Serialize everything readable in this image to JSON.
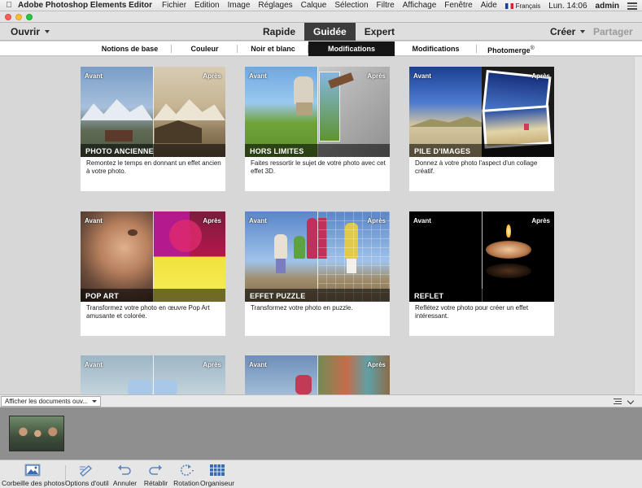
{
  "menubar": {
    "app_name": "Adobe Photoshop Elements Editor",
    "items": [
      "Fichier",
      "Edition",
      "Image",
      "Réglages",
      "Calque",
      "Sélection",
      "Filtre",
      "Affichage",
      "Fenêtre",
      "Aide"
    ],
    "language": "Français",
    "clock": "Lun. 14:06",
    "user": "admin"
  },
  "modebar": {
    "open_label": "Ouvrir",
    "modes": [
      "Rapide",
      "Guidée",
      "Expert"
    ],
    "active_mode": "Guidée",
    "create_label": "Créer",
    "share_label": "Partager"
  },
  "categories": {
    "items": [
      "Notions de base",
      "Couleur",
      "Noir et blanc",
      "Modifications amusantes",
      "Modifications spéciales",
      "Photomerge"
    ],
    "photomerge_mark": "®",
    "active": "Modifications amusantes"
  },
  "cards": {
    "before": "Avant",
    "after": "Après",
    "items": [
      {
        "title": "PHOTO ANCIENNE",
        "desc": "Remontez le temps en donnant un effet ancien à votre photo."
      },
      {
        "title": "HORS LIMITES",
        "desc": "Faites ressortir le sujet de votre photo avec cet effet 3D."
      },
      {
        "title": "PILE D'IMAGES",
        "desc": "Donnez à votre photo l'aspect d'un collage créatif."
      },
      {
        "title": "POP ART",
        "desc": "Transformez votre photo en œuvre Pop Art amusante et colorée."
      },
      {
        "title": "EFFET PUZZLE",
        "desc": "Transformez votre photo en puzzle."
      },
      {
        "title": "REFLET",
        "desc": "Reflétez votre photo pour créer un effet intéressant."
      }
    ]
  },
  "binbar": {
    "dropdown_value": "Afficher les documents ouv..."
  },
  "toolbar": {
    "items": [
      "Corbeille des photos",
      "Options d'outil",
      "Annuler",
      "Rétablir",
      "Rotation",
      "Organiseur"
    ]
  }
}
